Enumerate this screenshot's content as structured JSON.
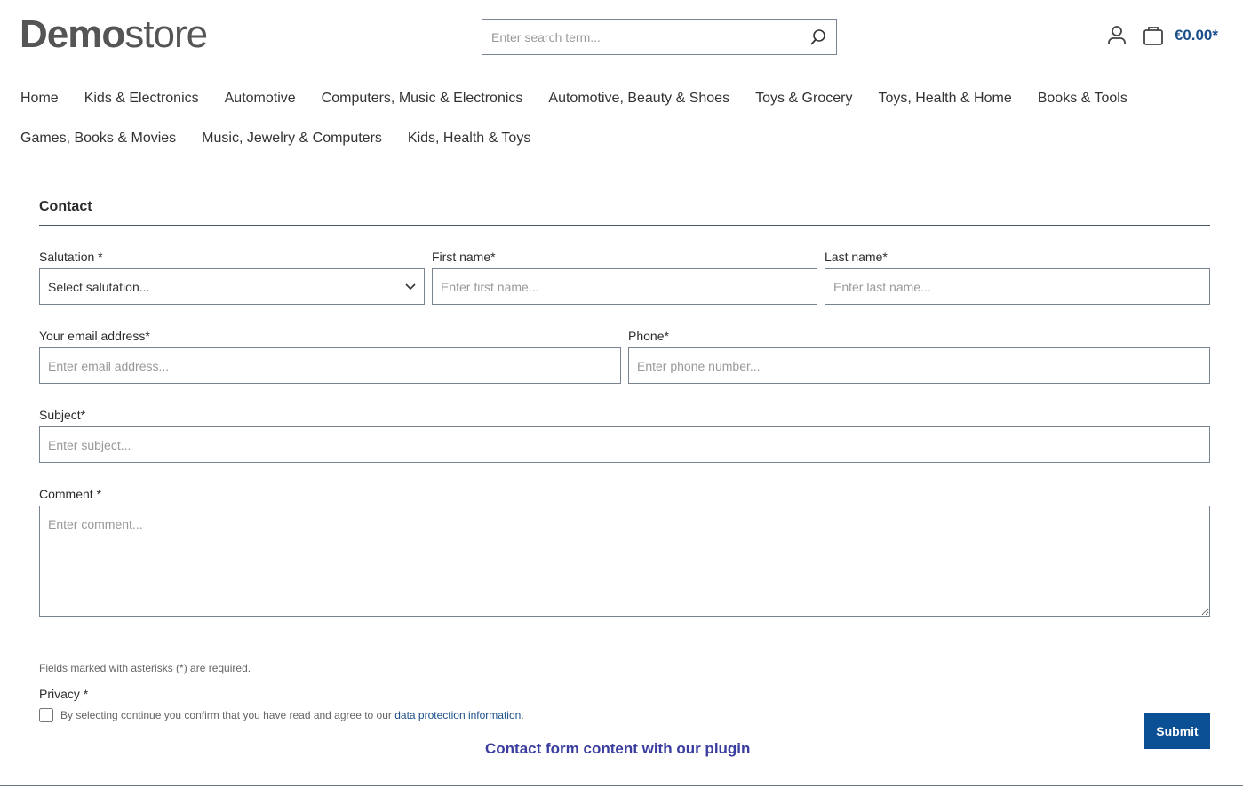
{
  "header": {
    "logo_bold": "Demo",
    "logo_light": "store",
    "search_placeholder": "Enter search term...",
    "cart_total": "€0.00*"
  },
  "nav": [
    "Home",
    "Kids & Electronics",
    "Automotive",
    "Computers, Music & Electronics",
    "Automotive, Beauty & Shoes",
    "Toys & Grocery",
    "Toys, Health & Home",
    "Books & Tools",
    "Games, Books & Movies",
    "Music, Jewelry & Computers",
    "Kids, Health & Toys"
  ],
  "form": {
    "title": "Contact",
    "salutation_label": "Salutation *",
    "salutation_value": "Select salutation...",
    "first_label": "First name*",
    "first_ph": "Enter first name...",
    "last_label": "Last name*",
    "last_ph": "Enter last name...",
    "email_label": "Your email address*",
    "email_ph": "Enter email address...",
    "phone_label": "Phone*",
    "phone_ph": "Enter phone number...",
    "subject_label": "Subject*",
    "subject_ph": "Enter subject...",
    "comment_label": "Comment *",
    "comment_ph": "Enter comment...",
    "required_note": "Fields marked with asterisks (*) are required.",
    "privacy_label": "Privacy *",
    "privacy_text": "By selecting continue you confirm that you have read and agree to our ",
    "privacy_link": "data protection information",
    "privacy_end": ".",
    "submit": "Submit"
  },
  "plugin_caption": "Contact form content with our plugin"
}
